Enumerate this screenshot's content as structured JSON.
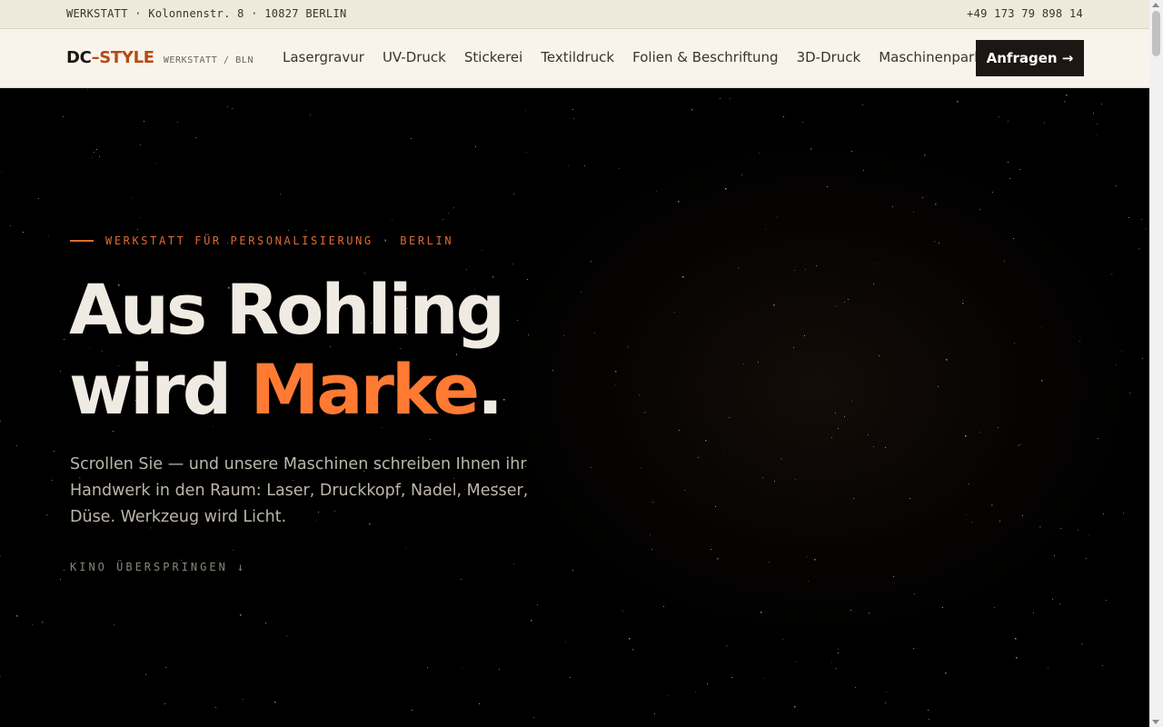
{
  "topbar": {
    "address": "WERKSTATT · Kolonnenstr. 8 · 10827 BERLIN",
    "phone": "+49 173 79 898 14"
  },
  "nav": {
    "logo_dc": "DC",
    "logo_style": "–STYLE",
    "logo_sub": "WERKSTATT / BLN",
    "links": [
      "Lasergravur",
      "UV-Druck",
      "Stickerei",
      "Textildruck",
      "Folien & Beschriftung",
      "3D-Druck",
      "Maschinenpark"
    ],
    "cta": "Anfragen →"
  },
  "hero": {
    "eyebrow": "WERKSTATT FÜR PERSONALISIERUNG · BERLIN",
    "headline_line1": "Aus Rohling",
    "headline_line2_pre": "wird ",
    "headline_accent": "Marke",
    "headline_end": ".",
    "lead": "Scrollen Sie — und unsere Maschinen schreiben Ihnen ihr Handwerk in den Raum: Laser, Druckkopf, Nadel, Messer, Düse. Werkzeug wird Licht.",
    "skip": "KINO ÜBERSPRINGEN ↓"
  },
  "colors": {
    "accent": "#ff7a33",
    "logo_accent": "#b84a12",
    "topbar_bg": "#efe9dc",
    "nav_bg": "#f8f4ec",
    "hero_bg": "#000000"
  }
}
